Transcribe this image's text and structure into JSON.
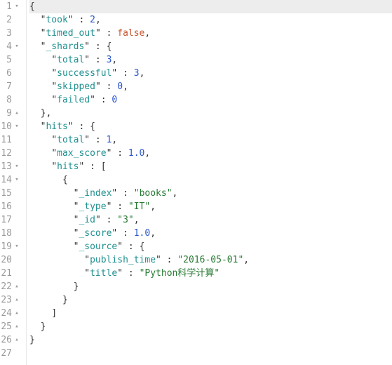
{
  "gutter": {
    "lines": [
      {
        "n": "1",
        "f": "▾"
      },
      {
        "n": "2",
        "f": ""
      },
      {
        "n": "3",
        "f": ""
      },
      {
        "n": "4",
        "f": "▾"
      },
      {
        "n": "5",
        "f": ""
      },
      {
        "n": "6",
        "f": ""
      },
      {
        "n": "7",
        "f": ""
      },
      {
        "n": "8",
        "f": ""
      },
      {
        "n": "9",
        "f": "▴"
      },
      {
        "n": "10",
        "f": "▾"
      },
      {
        "n": "11",
        "f": ""
      },
      {
        "n": "12",
        "f": ""
      },
      {
        "n": "13",
        "f": "▾"
      },
      {
        "n": "14",
        "f": "▾"
      },
      {
        "n": "15",
        "f": ""
      },
      {
        "n": "16",
        "f": ""
      },
      {
        "n": "17",
        "f": ""
      },
      {
        "n": "18",
        "f": ""
      },
      {
        "n": "19",
        "f": "▾"
      },
      {
        "n": "20",
        "f": ""
      },
      {
        "n": "21",
        "f": ""
      },
      {
        "n": "22",
        "f": "▴"
      },
      {
        "n": "23",
        "f": "▴"
      },
      {
        "n": "24",
        "f": "▴"
      },
      {
        "n": "25",
        "f": "▴"
      },
      {
        "n": "26",
        "f": "▴"
      },
      {
        "n": "27",
        "f": ""
      }
    ]
  },
  "code": {
    "l1": {
      "t0": "{"
    },
    "l2": {
      "i": "  ",
      "q0": "\"",
      "k": "took",
      "q1": "\"",
      "c": " : ",
      "v": "2",
      "e": ","
    },
    "l3": {
      "i": "  ",
      "q0": "\"",
      "k": "timed_out",
      "q1": "\"",
      "c": " : ",
      "v": "false",
      "e": ","
    },
    "l4": {
      "i": "  ",
      "q0": "\"",
      "k": "_shards",
      "q1": "\"",
      "c": " : ",
      "v": "{"
    },
    "l5": {
      "i": "    ",
      "q0": "\"",
      "k": "total",
      "q1": "\"",
      "c": " : ",
      "v": "3",
      "e": ","
    },
    "l6": {
      "i": "    ",
      "q0": "\"",
      "k": "successful",
      "q1": "\"",
      "c": " : ",
      "v": "3",
      "e": ","
    },
    "l7": {
      "i": "    ",
      "q0": "\"",
      "k": "skipped",
      "q1": "\"",
      "c": " : ",
      "v": "0",
      "e": ","
    },
    "l8": {
      "i": "    ",
      "q0": "\"",
      "k": "failed",
      "q1": "\"",
      "c": " : ",
      "v": "0"
    },
    "l9": {
      "i": "  ",
      "t0": "},"
    },
    "l10": {
      "i": "  ",
      "q0": "\"",
      "k": "hits",
      "q1": "\"",
      "c": " : ",
      "v": "{"
    },
    "l11": {
      "i": "    ",
      "q0": "\"",
      "k": "total",
      "q1": "\"",
      "c": " : ",
      "v": "1",
      "e": ","
    },
    "l12": {
      "i": "    ",
      "q0": "\"",
      "k": "max_score",
      "q1": "\"",
      "c": " : ",
      "v": "1.0",
      "e": ","
    },
    "l13": {
      "i": "    ",
      "q0": "\"",
      "k": "hits",
      "q1": "\"",
      "c": " : ",
      "v": "["
    },
    "l14": {
      "i": "      ",
      "t0": "{"
    },
    "l15": {
      "i": "        ",
      "q0": "\"",
      "k": "_index",
      "q1": "\"",
      "c": " : ",
      "vq0": "\"",
      "v": "books",
      "vq1": "\"",
      "e": ","
    },
    "l16": {
      "i": "        ",
      "q0": "\"",
      "k": "_type",
      "q1": "\"",
      "c": " : ",
      "vq0": "\"",
      "v": "IT",
      "vq1": "\"",
      "e": ","
    },
    "l17": {
      "i": "        ",
      "q0": "\"",
      "k": "_id",
      "q1": "\"",
      "c": " : ",
      "vq0": "\"",
      "v": "3",
      "vq1": "\"",
      "e": ","
    },
    "l18": {
      "i": "        ",
      "q0": "\"",
      "k": "_score",
      "q1": "\"",
      "c": " : ",
      "v": "1.0",
      "e": ","
    },
    "l19": {
      "i": "        ",
      "q0": "\"",
      "k": "_source",
      "q1": "\"",
      "c": " : ",
      "v": "{"
    },
    "l20": {
      "i": "          ",
      "q0": "\"",
      "k": "publish_time",
      "q1": "\"",
      "c": " : ",
      "vq0": "\"",
      "v": "2016-05-01",
      "vq1": "\"",
      "e": ","
    },
    "l21": {
      "i": "          ",
      "q0": "\"",
      "k": "title",
      "q1": "\"",
      "c": " : ",
      "vq0": "\"",
      "v": "Python科学计算",
      "vq1": "\""
    },
    "l22": {
      "i": "        ",
      "t0": "}"
    },
    "l23": {
      "i": "      ",
      "t0": "}"
    },
    "l24": {
      "i": "    ",
      "t0": "]"
    },
    "l25": {
      "i": "  ",
      "t0": "}"
    },
    "l26": {
      "t0": "}"
    },
    "l27": {
      "t0": ""
    }
  }
}
